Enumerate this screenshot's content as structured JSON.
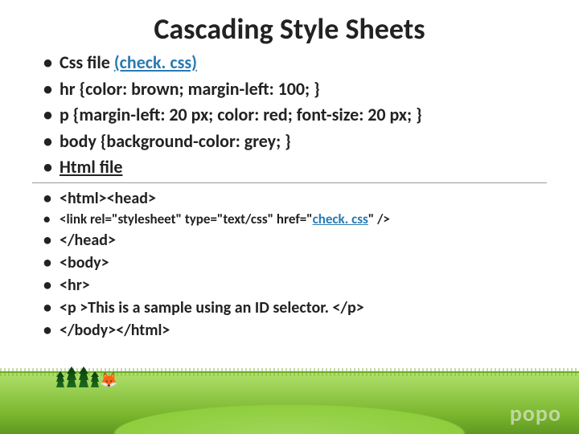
{
  "title": "Cascading Style Sheets",
  "section1": {
    "item0_prefix": "Css file ",
    "item0_link": "(check. css)",
    "item1": "hr {color: brown; margin-left: 100; }",
    "item2": "p {margin-left: 20 px; color: red; font-size: 20 px; }",
    "item3": "body {background-color: grey; }",
    "item4": "Html file"
  },
  "section2": {
    "item0": "<html><head>"
  },
  "section3": {
    "item0_prefix": "<link rel=\"stylesheet\" type=\"text/css\" href=\"",
    "item0_link": "check. css",
    "item0_suffix": "\" />"
  },
  "section4": {
    "item0": "</head>",
    "item1": "<body>",
    "item2": "<hr>",
    "item3": "<p >This is a sample using an ID selector. </p>",
    "item4": "</body></html>"
  },
  "watermark": "popo"
}
